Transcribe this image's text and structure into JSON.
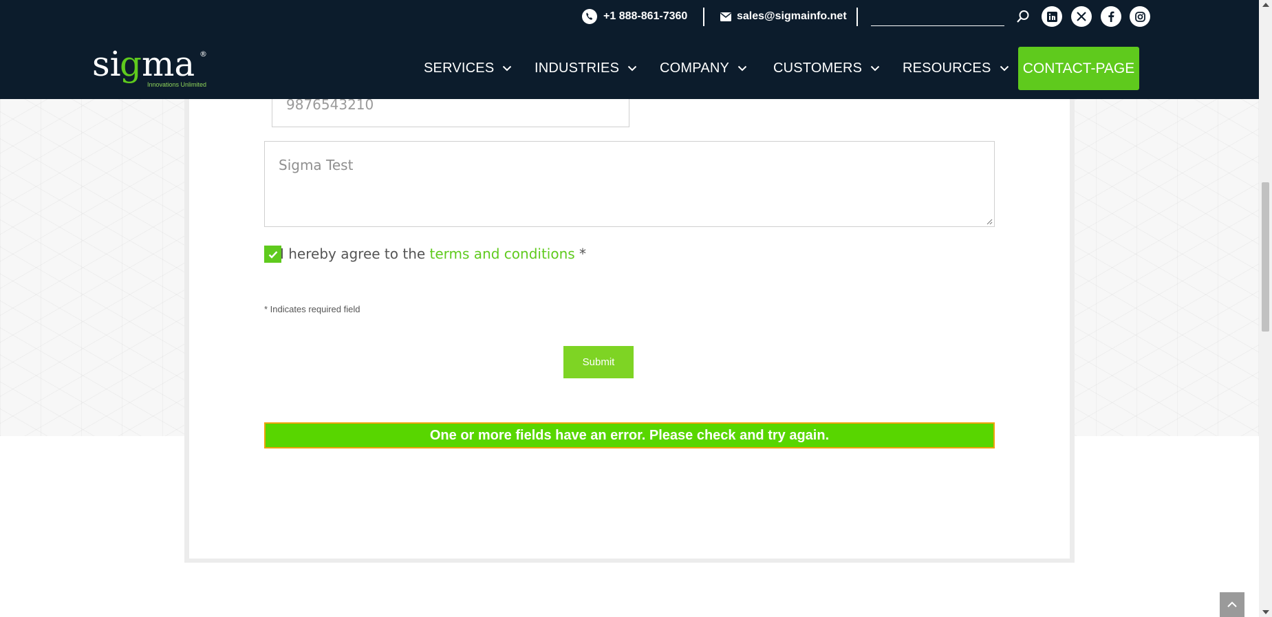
{
  "header": {
    "phone": "+1 888-861-7360",
    "email": "sales@sigmainfo.net",
    "search_placeholder": "",
    "social": [
      "linkedin-icon",
      "x-icon",
      "facebook-icon",
      "instagram-icon"
    ],
    "logo": {
      "text": "sigma",
      "registered": "®",
      "tagline": "Innovations Unlimited"
    },
    "nav": [
      {
        "label": "SERVICES"
      },
      {
        "label": "INDUSTRIES"
      },
      {
        "label": "COMPANY"
      },
      {
        "label": "CUSTOMERS"
      },
      {
        "label": "RESOURCES"
      }
    ],
    "cta_label": "CONTACT-PAGE"
  },
  "form": {
    "phone_value": "9876543210",
    "message_value": "Sigma Test",
    "agree_prefix": "I hereby agree to the",
    "agree_link": "terms and conditions",
    "agree_suffix": "*",
    "checkbox_checked": true,
    "required_note": "* Indicates required field",
    "submit_label": "Submit",
    "error_message": "One or more fields have an error. Please check and try again."
  },
  "colors": {
    "header_bg": "#0c1c2c",
    "accent_green": "#5fca1d",
    "error_bg": "#58d600",
    "error_border": "#f0a30a"
  }
}
